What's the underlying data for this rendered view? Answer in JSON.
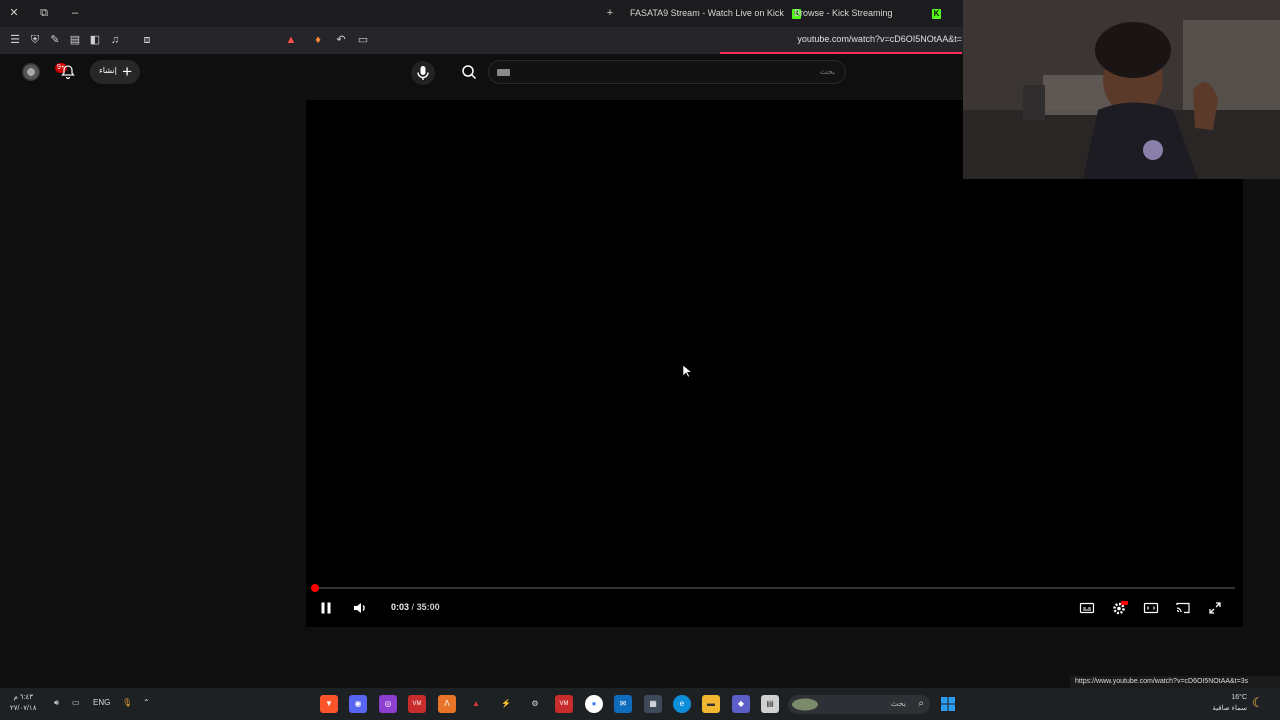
{
  "tabs": [
    {
      "label": "FASATA9 Stream - Watch Live on Kick"
    },
    {
      "label": "Browse - Kick Streaming"
    }
  ],
  "toolbar": {
    "url": "youtube.com/watch?v=cD6OI5NOtAA&t="
  },
  "youtube": {
    "create_label": "إنشاء",
    "notification_count": "9+",
    "search_placeholder": "بحث"
  },
  "player": {
    "current_time": "0:03",
    "separator": "/",
    "duration": "35:00",
    "progress_fraction": 0.0014
  },
  "status_url": "https://www.youtube.com/watch?v=cD6OI5NOtAA&t=3s",
  "taskbar": {
    "clock_time": "٦:٤٣ م",
    "clock_date": "٢٧/٠٧/١٨",
    "language": "ENG",
    "search_label": "بحث",
    "weather_temp": "16°C",
    "weather_desc": "سماء صافية"
  },
  "colors": {
    "youtube_red": "#ff0000",
    "kick_green": "#53fc18",
    "page_bg": "#0f0f0f"
  }
}
